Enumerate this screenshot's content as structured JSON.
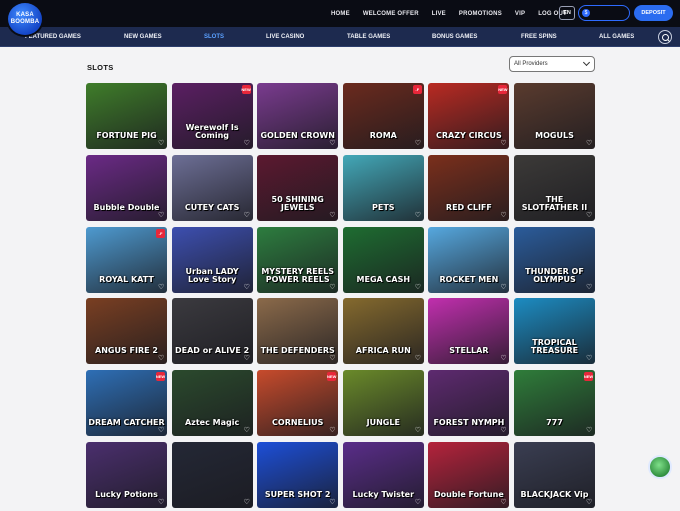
{
  "brand": {
    "line1": "KASA",
    "line2": "BOOMBA"
  },
  "topnav": [
    "HOME",
    "WELCOME OFFER",
    "LIVE",
    "PROMOTIONS",
    "VIP",
    "LOG OUT"
  ],
  "lang": "EN",
  "deposit_label": "DEPOSIT",
  "categories": [
    "FEATURED GAMES",
    "NEW GAMES",
    "SLOTS",
    "LIVE CASINO",
    "TABLE GAMES",
    "BONUS GAMES",
    "FREE SPINS",
    "ALL GAMES"
  ],
  "active_category": "SLOTS",
  "section_title": "SLOTS",
  "provider_filter": "All Providers",
  "games": [
    {
      "name": "FORTUNE PIG"
    },
    {
      "name": "Werewolf Is Coming"
    },
    {
      "name": "GOLDEN CROWN"
    },
    {
      "name": "ROMA"
    },
    {
      "name": "CRAZY CIRCUS"
    },
    {
      "name": "MOGULS"
    },
    {
      "name": "Bubble Double"
    },
    {
      "name": "CUTEY CATS"
    },
    {
      "name": "50 SHINING JEWELS"
    },
    {
      "name": "PETS"
    },
    {
      "name": "RED CLIFF"
    },
    {
      "name": "THE SLOTFATHER II"
    },
    {
      "name": "ROYAL KATT"
    },
    {
      "name": "Urban LADY Love Story"
    },
    {
      "name": "MYSTERY REELS POWER REELS"
    },
    {
      "name": "MEGA CASH"
    },
    {
      "name": "ROCKET MEN"
    },
    {
      "name": "THUNDER OF OLYMPUS"
    },
    {
      "name": "ANGUS FIRE 2"
    },
    {
      "name": "DEAD or ALIVE 2"
    },
    {
      "name": "THE DEFENDERS"
    },
    {
      "name": "AFRICA RUN"
    },
    {
      "name": "STELLAR"
    },
    {
      "name": "TROPICAL TREASURE"
    },
    {
      "name": "DREAM CATCHER"
    },
    {
      "name": "Aztec Magic"
    },
    {
      "name": "CORNELIUS"
    },
    {
      "name": "JUNGLE"
    },
    {
      "name": "FOREST NYMPH"
    },
    {
      "name": "777"
    },
    {
      "name": "Lucky Potions"
    },
    {
      "name": ""
    },
    {
      "name": "SUPER SHOT 2"
    },
    {
      "name": "Lucky Twister"
    },
    {
      "name": "Double Fortune"
    },
    {
      "name": "BLACKJACK Vip"
    }
  ],
  "tile_colors": [
    "#3f7d2a",
    "#5b1f63",
    "#7a3b8f",
    "#6b2a1e",
    "#b92a22",
    "#5a3b2e",
    "#6b2a86",
    "#6d6f96",
    "#5c1930",
    "#43a8b8",
    "#7b2f1c",
    "#3c3a38",
    "#4e9ad0",
    "#3d4fb0",
    "#2d7d3f",
    "#1e6d31",
    "#56a8df",
    "#2b5c9b",
    "#7a3f22",
    "#3b3a3f",
    "#8b6a4a",
    "#856a2e",
    "#c12fae",
    "#1c8cc2",
    "#2e6fb6",
    "#2b4a2d",
    "#c74b2c",
    "#6a8a2a",
    "#5e2a70",
    "#2f7d3a",
    "#4b2f6e",
    "#242836",
    "#1d4fd8",
    "#5a2d8a",
    "#b5233c",
    "#3a3e52"
  ],
  "badges": [
    {
      "tile": 1,
      "text": "NEW"
    },
    {
      "tile": 3,
      "text": "-F"
    },
    {
      "tile": 4,
      "text": "NEW"
    },
    {
      "tile": 12,
      "text": "-F"
    },
    {
      "tile": 24,
      "text": "NEW"
    },
    {
      "tile": 26,
      "text": "NEW"
    },
    {
      "tile": 29,
      "text": "NEW"
    }
  ]
}
